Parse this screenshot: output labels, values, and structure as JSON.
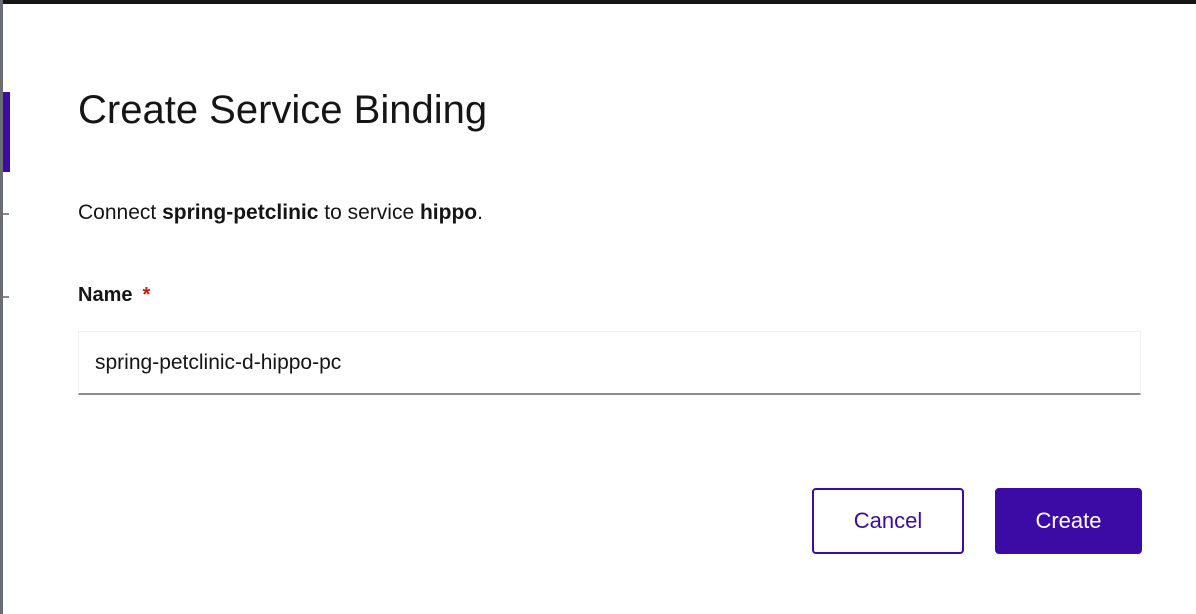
{
  "modal": {
    "title": "Create Service Binding",
    "description": {
      "prefix": "Connect ",
      "source": "spring-petclinic",
      "middle": " to service ",
      "target": "hippo",
      "suffix": "."
    },
    "name_field": {
      "label": "Name",
      "required_mark": "*",
      "value": "spring-petclinic-d-hippo-pc"
    },
    "buttons": {
      "cancel_label": "Cancel",
      "create_label": "Create"
    }
  },
  "colors": {
    "primary": "#3c0ba5",
    "required": "#c9190b",
    "text": "#151515"
  }
}
